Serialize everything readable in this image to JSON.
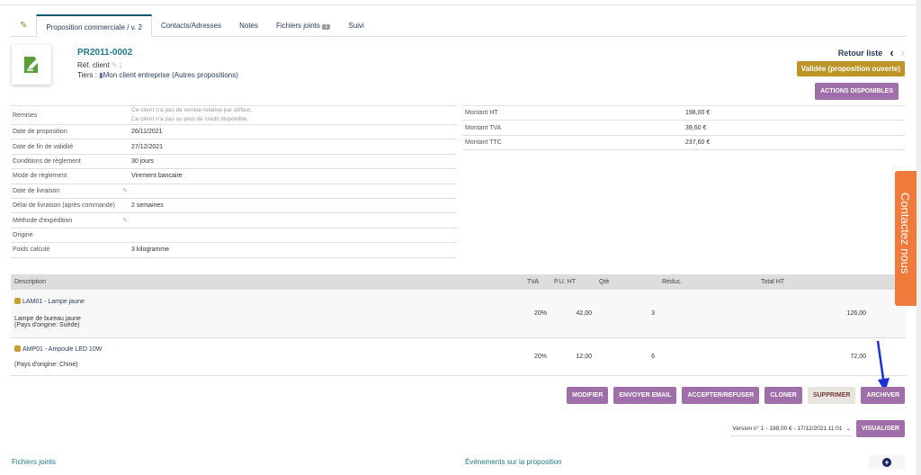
{
  "tabs": [
    {
      "label": "Proposition commerciale / v. 2"
    },
    {
      "label": "Contacts/Adresses"
    },
    {
      "label": "Notes"
    },
    {
      "label": "Fichiers joints",
      "badge": "1"
    },
    {
      "label": "Suivi"
    }
  ],
  "header": {
    "ref": "PR2011-0002",
    "ref_client_label": "Réf. client",
    "ref_client_suffix": ":",
    "tiers_label": "Tiers :",
    "tiers_value": "Mon client entreprise",
    "tiers_link": "(Autres propositions)",
    "back_label": "Retour liste",
    "prev_icon": "‹",
    "next_icon": "›",
    "status": "Validée (proposition ouverte)",
    "actions_label": "ACTIONS DISPONIBLES"
  },
  "fields": [
    {
      "label": "Remises",
      "value": "Ce client n'a pas de remise relative par défaut.",
      "value2": "Ce client n'a pas ou plus de crédit disponible."
    },
    {
      "label": "Date de proposition",
      "value": "26/11/2021"
    },
    {
      "label": "Date de fin de validité",
      "value": "27/12/2021"
    },
    {
      "label": "Conditions de règlement",
      "value": "30 jours"
    },
    {
      "label": "Mode de règlement",
      "value": "Virement bancaire"
    },
    {
      "label": "Date de livraison",
      "value": ""
    },
    {
      "label": "Délai de livraison (après commande)",
      "value": "2 semaines"
    },
    {
      "label": "Méthode d'expédition",
      "value": ""
    },
    {
      "label": "Origine",
      "value": ""
    },
    {
      "label": "Poids calculé",
      "value": "3 kilogramme"
    }
  ],
  "totals": [
    {
      "label": "Montant HT",
      "value": "198,00 €"
    },
    {
      "label": "Montant TVA",
      "value": "39,60 €"
    },
    {
      "label": "Montant TTC",
      "value": "237,60 €"
    }
  ],
  "lines": {
    "headers": {
      "desc": "Description",
      "tva": "TVA",
      "pu": "P.U. HT",
      "qty": "Qté",
      "reduc": "Réduc.",
      "total": "Total HT"
    },
    "rows": [
      {
        "product": "LAM01 - Lampe jaune",
        "desc": "Lampe de bureau jaune",
        "origin": "(Pays d'origine: Suède)",
        "tva": "20%",
        "pu": "42,00",
        "qty": "3",
        "total": "126,00"
      },
      {
        "product": "AMP01 - Ampoule LED 10W",
        "desc": "",
        "origin": "(Pays d'origine: Chine)",
        "tva": "20%",
        "pu": "12,00",
        "qty": "6",
        "total": "72,00"
      }
    ]
  },
  "buttons": {
    "modify": "MODIFIER",
    "email": "ENVOYER EMAIL",
    "accept": "ACCEPTER/REFUSER",
    "clone": "CLONER",
    "delete": "SUPPRIMER",
    "archive": "ARCHIVER"
  },
  "version": {
    "selected": "Version n° 1 - 198,00 € - 17/12/2021 11:01",
    "button": "VISUALISER"
  },
  "bottom": {
    "files": "Fichiers joints",
    "events": "Événements sur la proposition"
  },
  "contact": "Contactez nous",
  "colors": {
    "accent": "#a06ea8",
    "status": "#bc9526",
    "contact": "#f07a3a"
  }
}
